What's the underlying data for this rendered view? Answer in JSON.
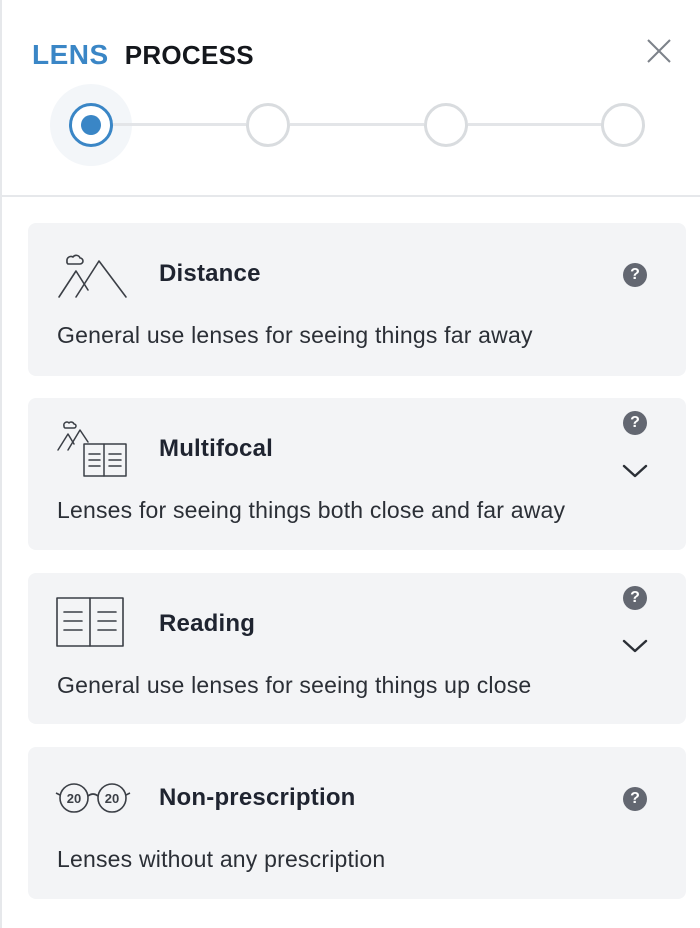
{
  "header": {
    "title_brand": "LENS",
    "title_main": "PROCESS"
  },
  "stepper": {
    "step_count": 4,
    "active_step": 1
  },
  "options": [
    {
      "title": "Distance",
      "description": "General use lenses for seeing things far away",
      "icon": "mountains-icon",
      "has_help": true,
      "has_expand": false
    },
    {
      "title": "Multifocal",
      "description": "Lenses for seeing things both close and far away",
      "icon": "mountains-book-icon",
      "has_help": true,
      "has_expand": true
    },
    {
      "title": "Reading",
      "description": "General use lenses for seeing things up close",
      "icon": "open-book-icon",
      "has_help": true,
      "has_expand": true
    },
    {
      "title": "Non-prescription",
      "description": "Lenses without any prescription",
      "icon": "glasses-20-20-icon",
      "icon_text": "20",
      "has_help": true,
      "has_expand": false
    }
  ],
  "help_glyph": "?",
  "colors": {
    "accent": "#3a86c6",
    "card_bg": "#f3f4f6",
    "help_bg": "#636771",
    "step_border": "#d9dcdf"
  }
}
